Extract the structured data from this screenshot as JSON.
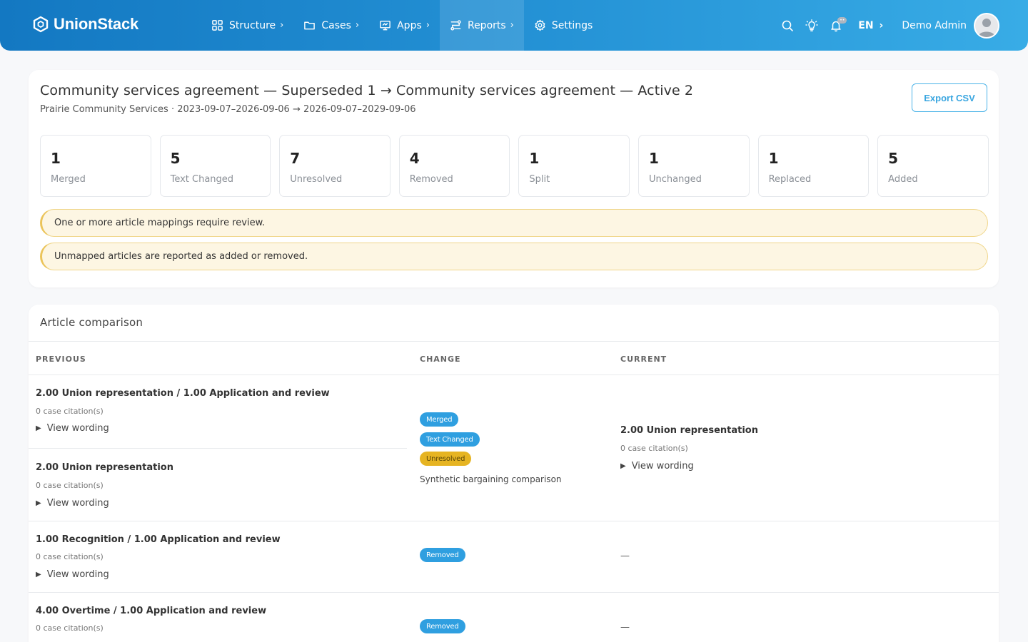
{
  "header": {
    "brand": "UnionStack",
    "nav": [
      {
        "label": "Structure"
      },
      {
        "label": "Cases"
      },
      {
        "label": "Apps"
      },
      {
        "label": "Reports"
      },
      {
        "label": "Settings"
      }
    ],
    "lang": "EN",
    "user": "Demo Admin"
  },
  "summary": {
    "title": "Community services agreement — Superseded 1 → Community services agreement — Active 2",
    "subtitle": "Prairie Community Services · 2023-09-07–2026-09-06 → 2026-09-07–2029-09-06",
    "export_label": "Export CSV",
    "stats": [
      {
        "value": "1",
        "label": "Merged"
      },
      {
        "value": "5",
        "label": "Text Changed"
      },
      {
        "value": "7",
        "label": "Unresolved"
      },
      {
        "value": "4",
        "label": "Removed"
      },
      {
        "value": "1",
        "label": "Split"
      },
      {
        "value": "1",
        "label": "Unchanged"
      },
      {
        "value": "1",
        "label": "Replaced"
      },
      {
        "value": "5",
        "label": "Added"
      }
    ],
    "alerts": [
      "One or more article mappings require review.",
      "Unmapped articles are reported as added or removed."
    ]
  },
  "comparison": {
    "title": "Article comparison",
    "headers": {
      "previous": "PREVIOUS",
      "change": "CHANGE",
      "current": "CURRENT"
    },
    "view_wording": "View wording",
    "rows": [
      {
        "previous": [
          {
            "title": "2.00 Union representation / 1.00 Application and review",
            "cite": "0 case citation(s)"
          },
          {
            "title": "2.00 Union representation",
            "cite": "0 case citation(s)"
          }
        ],
        "badges": [
          "Merged",
          "Text Changed",
          "Unresolved"
        ],
        "note": "Synthetic bargaining comparison",
        "current": {
          "title": "2.00 Union representation",
          "cite": "0 case citation(s)"
        }
      },
      {
        "previous": [
          {
            "title": "1.00 Recognition / 1.00 Application and review",
            "cite": "0 case citation(s)"
          }
        ],
        "badges": [
          "Removed"
        ],
        "current_dash": "—"
      },
      {
        "previous": [
          {
            "title": "4.00 Overtime / 1.00 Application and review",
            "cite": "0 case citation(s)"
          }
        ],
        "badges": [
          "Removed"
        ],
        "current_dash": "—"
      }
    ]
  }
}
